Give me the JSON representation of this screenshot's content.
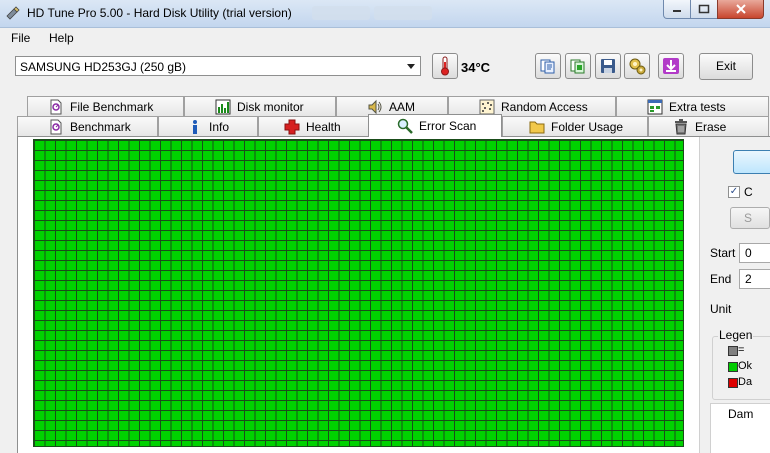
{
  "window": {
    "title": "HD Tune Pro 5.00 - Hard Disk Utility (trial version)"
  },
  "menu": {
    "file": "File",
    "help": "Help"
  },
  "toolbar": {
    "drive": "SAMSUNG HD253GJ (250 gB)",
    "temperature": "34°C",
    "exit": "Exit",
    "icons": [
      "copy-text-icon",
      "copy-screen-icon",
      "save-icon",
      "options-icon",
      "download-icon"
    ]
  },
  "tabs": {
    "row1": [
      "File Benchmark",
      "Disk monitor",
      "AAM",
      "Random Access",
      "Extra tests"
    ],
    "row2": [
      "Benchmark",
      "Info",
      "Health",
      "Error Scan",
      "Folder Usage",
      "Erase"
    ],
    "active": "Error Scan"
  },
  "side": {
    "checkbox_label": "C",
    "small_button": "S",
    "start_label": "Start",
    "start_value": "0",
    "end_label": "End",
    "end_value": "2",
    "unit_label": "Unit",
    "legend_title": "Legen",
    "legend": [
      {
        "label": "=",
        "color": "#808080"
      },
      {
        "label": "Ok",
        "color": "#00cc00"
      },
      {
        "label": "Da",
        "color": "#dd0000"
      }
    ],
    "damaged_label": "Dam"
  },
  "colors": {
    "block_ok": "#00d200",
    "grid_line": "#1a4d1a"
  }
}
